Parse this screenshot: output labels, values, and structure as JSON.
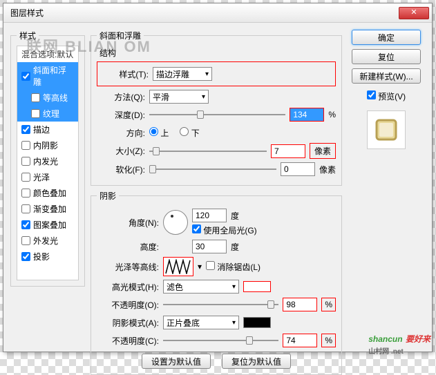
{
  "dialog": {
    "title": "图层样式"
  },
  "left": {
    "header": "样式",
    "blend": "混合选项:默认",
    "items": [
      {
        "label": "斜面和浮雕",
        "checked": true,
        "sel": true
      },
      {
        "label": "等高线",
        "checked": false,
        "indent": true,
        "sel": true,
        "sub": true
      },
      {
        "label": "纹理",
        "checked": false,
        "indent": true,
        "sel": true,
        "sub": true
      },
      {
        "label": "描边",
        "checked": true
      },
      {
        "label": "内阴影",
        "checked": false
      },
      {
        "label": "内发光",
        "checked": false
      },
      {
        "label": "光泽",
        "checked": false
      },
      {
        "label": "颜色叠加",
        "checked": false
      },
      {
        "label": "渐变叠加",
        "checked": false
      },
      {
        "label": "图案叠加",
        "checked": true
      },
      {
        "label": "外发光",
        "checked": false
      },
      {
        "label": "投影",
        "checked": true
      }
    ]
  },
  "bevel": {
    "section": "斜面和浮雕",
    "struct": "结构",
    "style_l": "样式(T):",
    "style_v": "描边浮雕",
    "tech_l": "方法(Q):",
    "tech_v": "平滑",
    "depth_l": "深度(D):",
    "depth_v": "134",
    "depth_u": "%",
    "dir_l": "方向:",
    "up": "上",
    "down": "下",
    "size_l": "大小(Z):",
    "size_v": "7",
    "size_u": "像素",
    "soft_l": "软化(F):",
    "soft_v": "0",
    "soft_u": "像素"
  },
  "shade": {
    "section": "阴影",
    "angle_l": "角度(N):",
    "angle_v": "120",
    "deg": "度",
    "global": "使用全局光(G)",
    "alt_l": "高度:",
    "alt_v": "30",
    "gloss_l": "光泽等高线:",
    "aa": "消除锯齿(L)",
    "hi_l": "高光模式(H):",
    "hi_v": "滤色",
    "hi_op_l": "不透明度(O):",
    "hi_op_v": "98",
    "pct": "%",
    "sh_l": "阴影模式(A):",
    "sh_v": "正片叠底",
    "sh_op_l": "不透明度(C):",
    "sh_op_v": "74"
  },
  "bottom": {
    "def": "设置为默认值",
    "reset": "复位为默认值"
  },
  "right": {
    "ok": "确定",
    "cancel": "复位",
    "new": "新建样式(W)...",
    "preview": "预览(V)"
  },
  "wm": "联网 BLIAN  OM",
  "wm2": "shancun",
  "wm2b": "山村网 .net",
  "wm3": "要好来"
}
